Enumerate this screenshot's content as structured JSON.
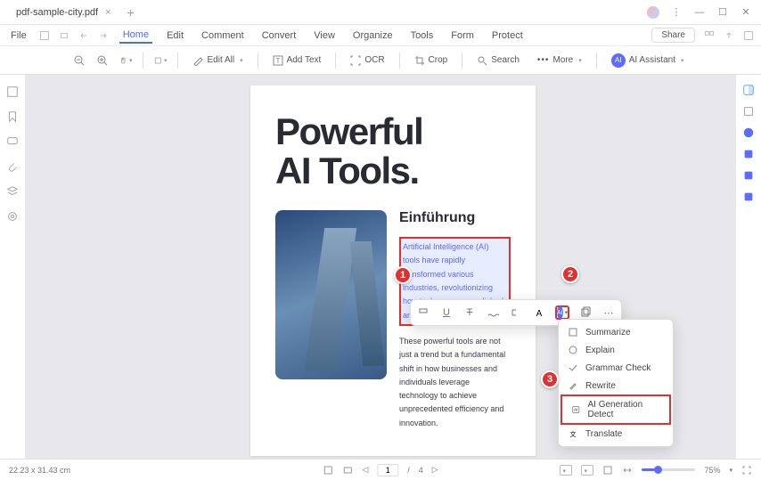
{
  "titlebar": {
    "tab_name": "pdf-sample-city.pdf"
  },
  "menubar": {
    "file": "File",
    "items": [
      "Home",
      "Edit",
      "Comment",
      "Convert",
      "View",
      "Organize",
      "Tools",
      "Form",
      "Protect"
    ],
    "active_index": 0,
    "share": "Share"
  },
  "toolbar": {
    "edit_all": "Edit All",
    "add_text": "Add Text",
    "ocr": "OCR",
    "crop": "Crop",
    "search": "Search",
    "more": "More",
    "ai_assistant": "AI Assistant"
  },
  "document": {
    "title_line1": "Powerful",
    "title_line2": "AI Tools.",
    "subheading": "Einführung",
    "highlighted_text": "Artificial Intelligence (AI) tools have rapidly transformed various industries, revolutionizing how tasks are accomplished, and insights are derived.",
    "body_text": "These powerful tools are not just a trend but a fundamental shift in how businesses and individuals leverage technology to achieve unprecedented efficiency and innovation."
  },
  "callouts": {
    "one": "1",
    "two": "2",
    "three": "3"
  },
  "ai_menu": {
    "items": [
      "Summarize",
      "Explain",
      "Grammar Check",
      "Rewrite",
      "AI Generation Detect",
      "Translate"
    ],
    "highlighted_index": 4
  },
  "statusbar": {
    "dimensions": "22.23 x 31.43 cm",
    "page_current": "1",
    "page_total": "4",
    "zoom": "75%"
  }
}
